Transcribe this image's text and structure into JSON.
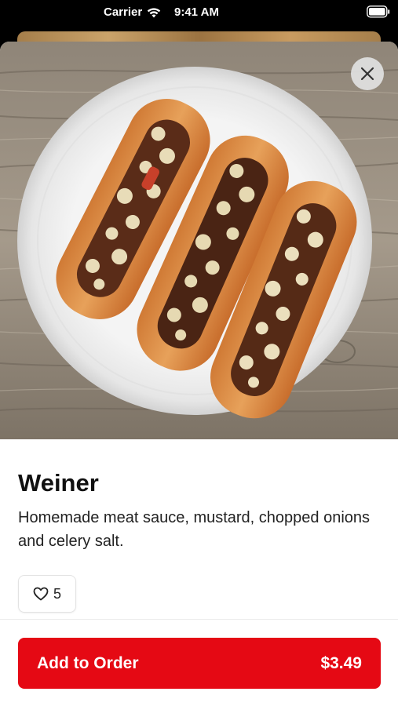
{
  "status_bar": {
    "carrier": "Carrier",
    "time": "9:41 AM"
  },
  "item": {
    "name": "Weiner",
    "description": "Homemade meat sauce, mustard, chopped onions and celery salt.",
    "likes": "5",
    "image_icon": "hot-dogs-on-plate-photo"
  },
  "actions": {
    "close_icon": "close-icon",
    "add_label": "Add to Order",
    "price": "$3.49"
  },
  "colors": {
    "accent": "#e50914",
    "text": "#111111"
  }
}
